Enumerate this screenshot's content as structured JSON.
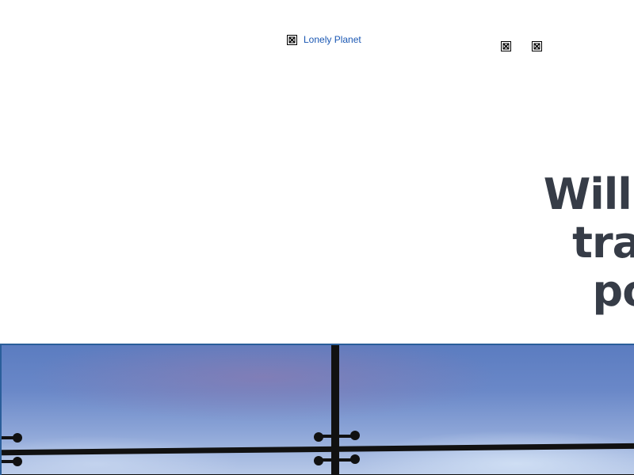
{
  "header": {
    "logo_alt": "Lonely Planet",
    "icons": [
      "broken-image-icon",
      "broken-image-icon"
    ]
  },
  "article": {
    "headline_lines": [
      "Will sus",
      "trave",
      "pos"
    ]
  },
  "hero": {
    "description_icon": "glass-railing-sky-photo"
  }
}
